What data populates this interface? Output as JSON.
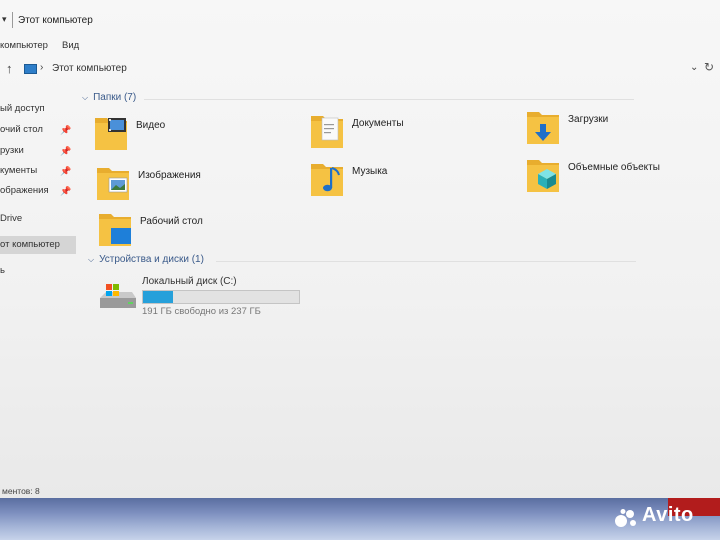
{
  "window": {
    "title": "Этот компьютер",
    "quick_access_icon": "chevron-down-icon"
  },
  "ribbon": {
    "tabs": [
      "компьютер",
      "Вид"
    ]
  },
  "address": {
    "back_icon": "up-arrow-icon",
    "breadcrumb": "Этот компьютер"
  },
  "nav": {
    "items": [
      {
        "label": "ый доступ",
        "pinned": false
      },
      {
        "label": "очий стол",
        "pinned": true
      },
      {
        "label": "рузки",
        "pinned": true
      },
      {
        "label": "кументы",
        "pinned": true
      },
      {
        "label": "ображения",
        "pinned": true
      },
      {
        "label": "Drive",
        "pinned": false
      },
      {
        "label": "от компьютер",
        "pinned": false,
        "selected": true
      },
      {
        "label": "ь",
        "pinned": false
      }
    ]
  },
  "folders_group": {
    "header": "Папки (7)",
    "items": [
      {
        "label": "Видео",
        "icon": "video-folder-icon"
      },
      {
        "label": "Документы",
        "icon": "documents-folder-icon"
      },
      {
        "label": "Загрузки",
        "icon": "downloads-folder-icon"
      },
      {
        "label": "Изображения",
        "icon": "pictures-folder-icon"
      },
      {
        "label": "Музыка",
        "icon": "music-folder-icon"
      },
      {
        "label": "Объемные объекты",
        "icon": "3d-objects-folder-icon"
      },
      {
        "label": "Рабочий стол",
        "icon": "desktop-folder-icon"
      }
    ]
  },
  "devices_group": {
    "header": "Устройства и диски (1)",
    "drive": {
      "name": "Локальный диск (C:)",
      "free_text": "191 ГБ свободно из 237 ГБ",
      "used_fraction": 0.194,
      "bar_color": "#26a0da",
      "icon": "hard-drive-icon"
    }
  },
  "status": {
    "text": "ментов: 8"
  },
  "watermark": {
    "text": "Avito"
  },
  "colors": {
    "group_header": "#3a5a8a",
    "folder_yellow": "#f5c243",
    "selected_nav": "#d5d5d5"
  }
}
